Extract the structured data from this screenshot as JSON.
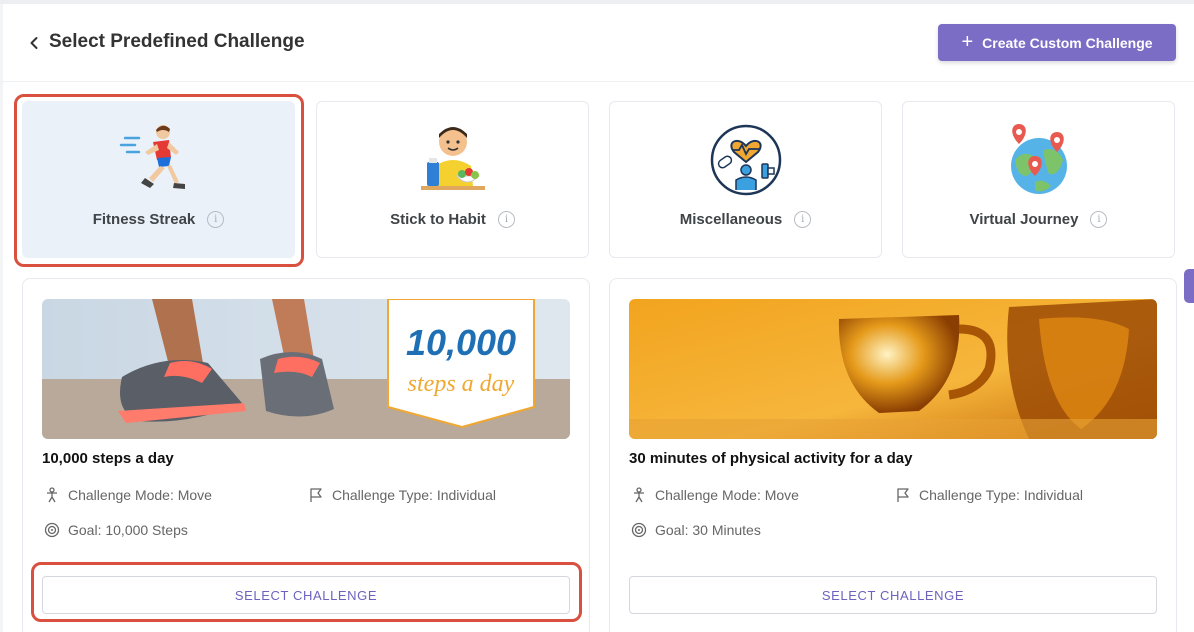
{
  "header": {
    "title": "Select Predefined Challenge",
    "create_button_label": "Create Custom Challenge"
  },
  "categories": [
    {
      "label": "Fitness Streak",
      "icon": "runner-icon",
      "selected": true
    },
    {
      "label": "Stick to Habit",
      "icon": "healthy-habit-icon",
      "selected": false
    },
    {
      "label": "Miscellaneous",
      "icon": "wellness-icon",
      "selected": false
    },
    {
      "label": "Virtual Journey",
      "icon": "globe-pins-icon",
      "selected": false
    }
  ],
  "challenges": [
    {
      "title": "10,000 steps a day",
      "banner_number": "10,000",
      "banner_text": "steps a day",
      "mode": "Challenge Mode: Move",
      "type": "Challenge Type: Individual",
      "goal": "Goal: 10,000 Steps",
      "button_label": "SELECT CHALLENGE"
    },
    {
      "title": "30 minutes of physical activity for a day",
      "mode": "Challenge Mode: Move",
      "type": "Challenge Type: Individual",
      "goal": "Goal: 30 Minutes",
      "button_label": "SELECT CHALLENGE"
    }
  ],
  "colors": {
    "accent": "#7b6cc5",
    "highlight": "#d9503f",
    "selected_card_bg": "#ebf1f9"
  }
}
